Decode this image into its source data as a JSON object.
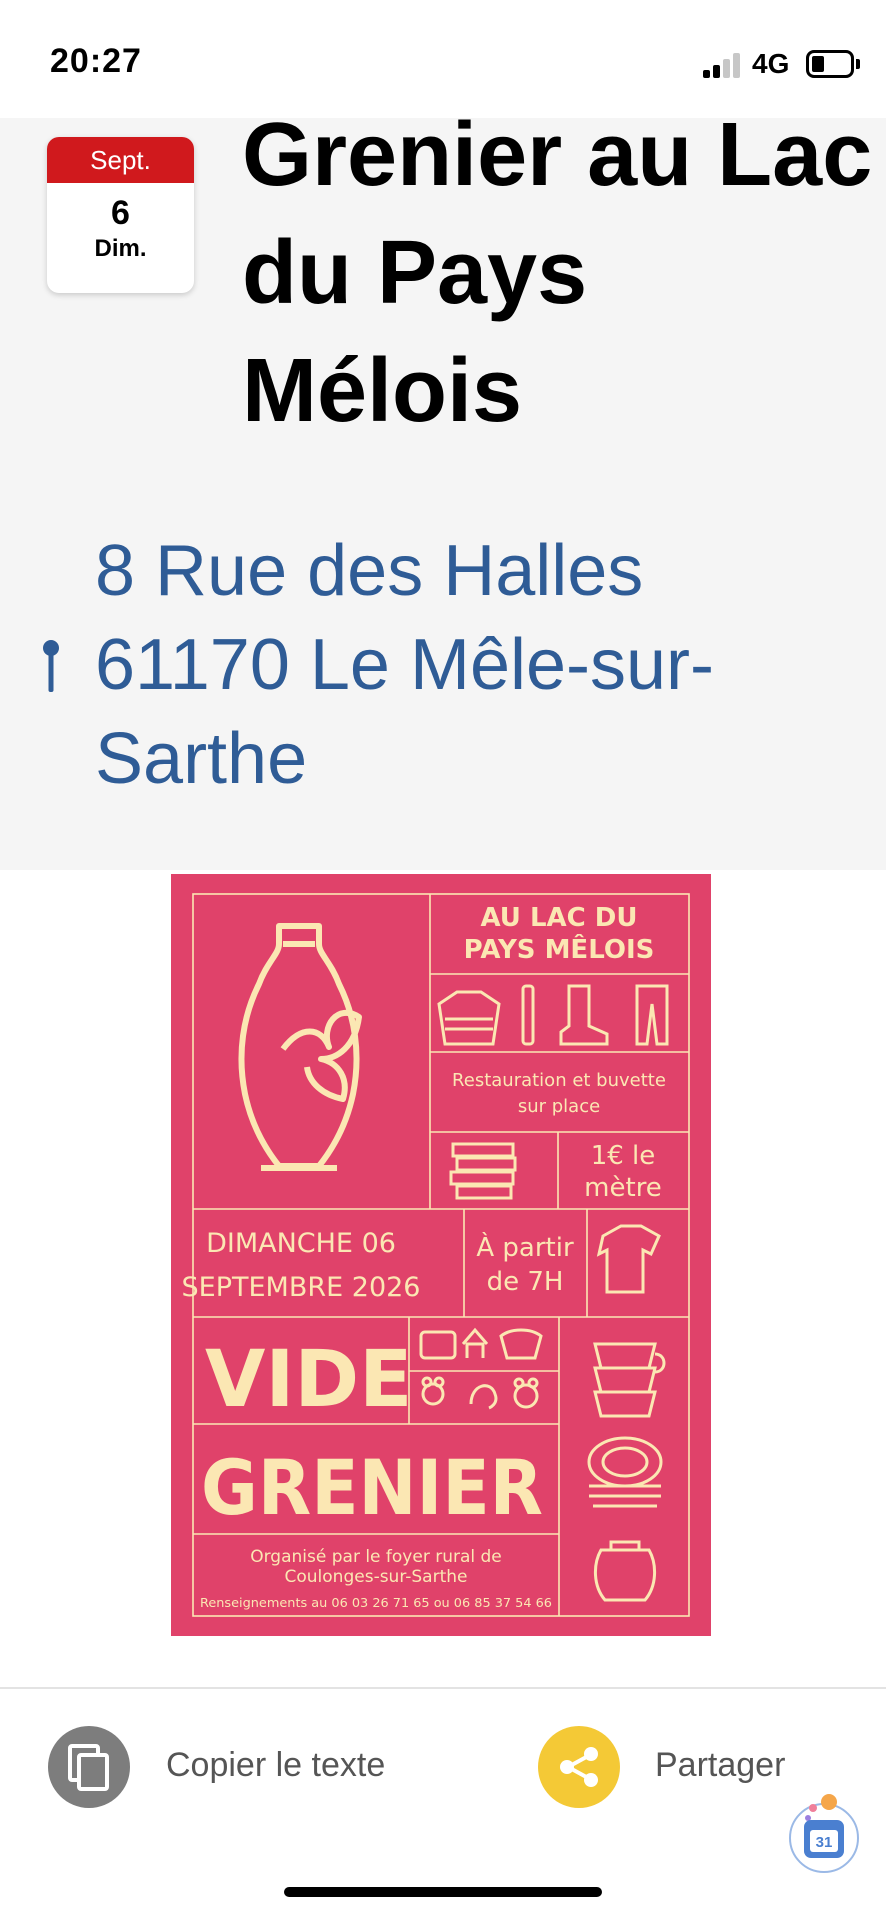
{
  "status_bar": {
    "time": "20:27",
    "network": "4G",
    "icons": [
      "signal-icon",
      "battery-icon"
    ]
  },
  "event": {
    "date": {
      "month": "Sept.",
      "day": "6",
      "weekday": "Dim."
    },
    "title": "Grenier au Lac du Pays Mélois",
    "address_line1": "8 Rue des Halles",
    "address_line2": "61170 Le Mêle-sur-Sarthe"
  },
  "poster": {
    "background_color": "#e0426a",
    "ink_color": "#fbe7b3",
    "location_line1": "AU LAC DU",
    "location_line2": "PAYS MÊLOIS",
    "food_line1": "Restauration et buvette",
    "food_line2": "sur place",
    "price_line1": "1€ le",
    "price_line2": "mètre",
    "date_line1": "DIMANCHE 06",
    "date_line2": "SEPTEMBRE 2026",
    "time_line1": "À partir",
    "time_line2": "de 7H",
    "headline1": "VIDE",
    "headline2": "GRENIER",
    "organizer_line1": "Organisé par le foyer rural de",
    "organizer_line2": "Coulonges-sur-Sarthe",
    "contact": "Renseignements au 06 03 26 71 65 ou 06 85 37 54 66"
  },
  "actions": {
    "copy_label": "Copier le texte",
    "share_label": "Partager",
    "calendar_fab_day": "31"
  },
  "colors": {
    "accent_red": "#d0191d",
    "address_blue": "#2f5c96",
    "share_yellow": "#f4c936",
    "copy_gray": "#7d7d7d"
  }
}
